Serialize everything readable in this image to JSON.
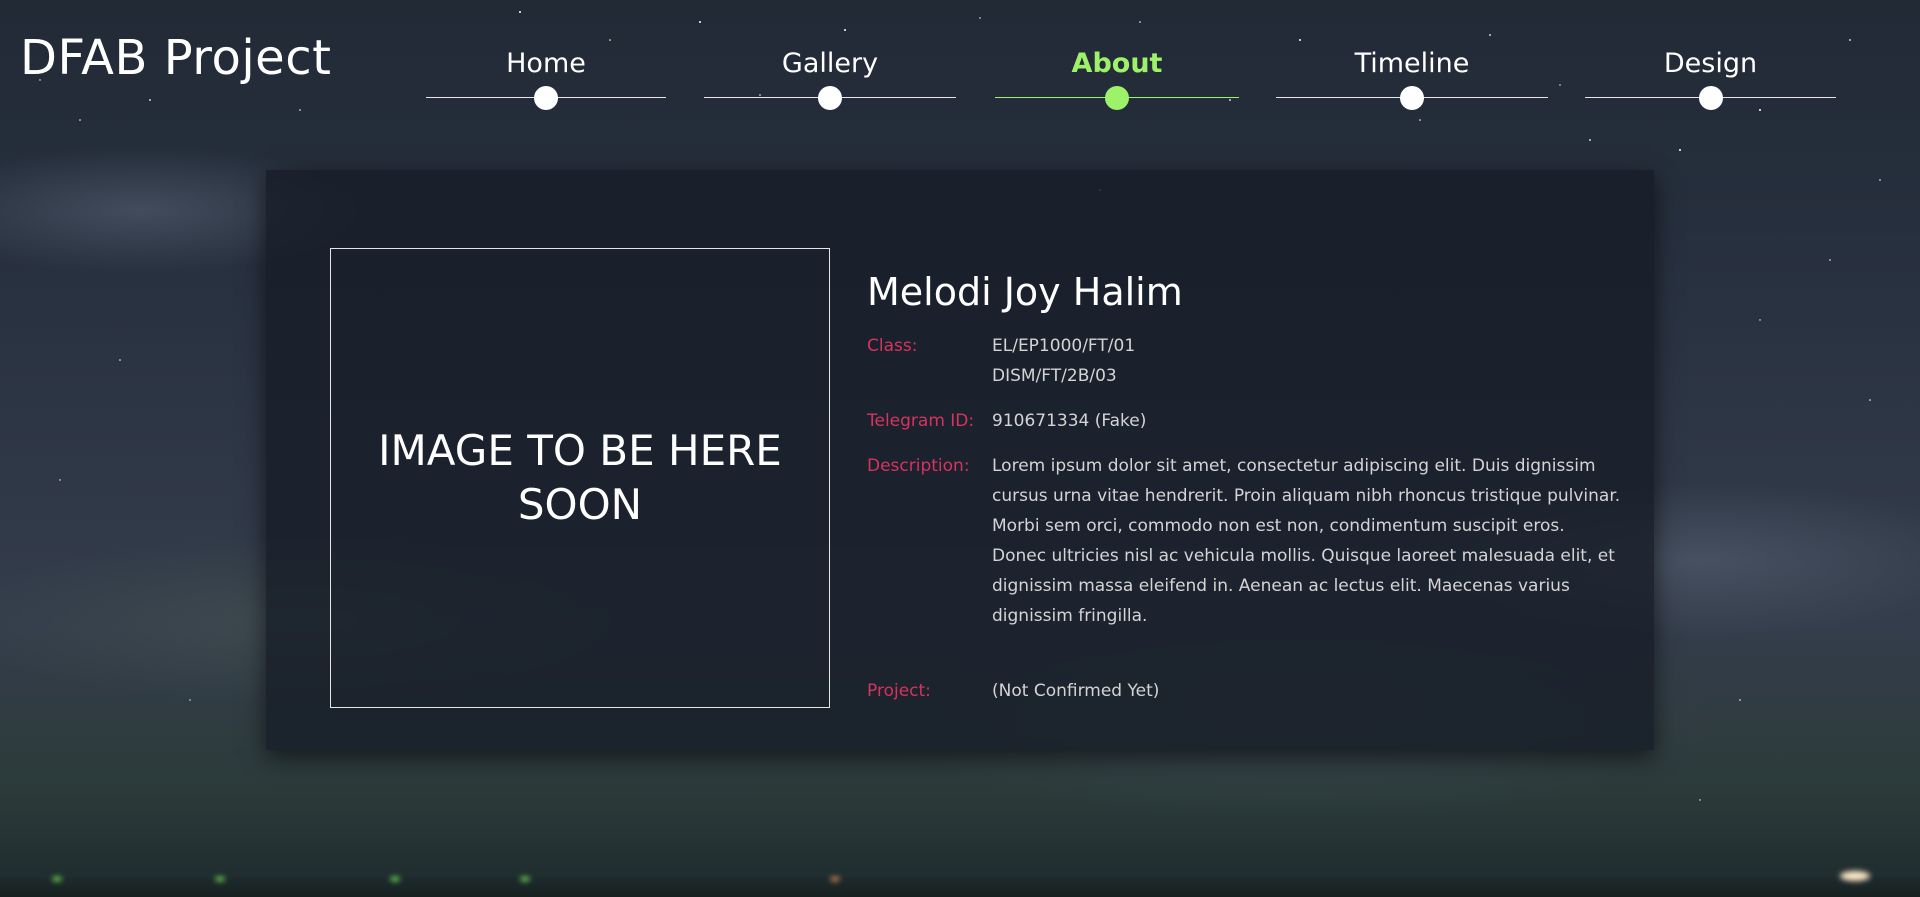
{
  "brand": {
    "title": "DFAB Project"
  },
  "nav": {
    "items": [
      {
        "label": "Home"
      },
      {
        "label": "Gallery"
      },
      {
        "label": "About"
      },
      {
        "label": "Timeline"
      },
      {
        "label": "Design"
      }
    ],
    "active": "About",
    "active_color": "#9ef26a"
  },
  "profile": {
    "image_placeholder": "IMAGE TO BE HERE SOON",
    "name": "Melodi Joy Halim",
    "class_label": "Class:",
    "class_values": [
      "EL/EP1000/FT/01",
      "DISM/FT/2B/03"
    ],
    "telegram_label": "Telegram ID:",
    "telegram_value": "910671334 (Fake)",
    "description_label": "Description:",
    "description_value": "Lorem ipsum dolor sit amet, consectetur adipiscing elit. Duis dignissim cursus urna vitae hendrerit. Proin aliquam nibh rhoncus tristique pulvinar. Morbi sem orci, commodo non est non, condimentum suscipit eros. Donec ultricies nisl ac vehicula mollis. Quisque laoreet malesuada elit, et dignissim massa eleifend in. Aenean ac lectus elit. Maecenas varius dignissim fringilla.",
    "project_label": "Project:",
    "project_value": "(Not Confirmed Yet)",
    "label_color": "#d6335f"
  }
}
